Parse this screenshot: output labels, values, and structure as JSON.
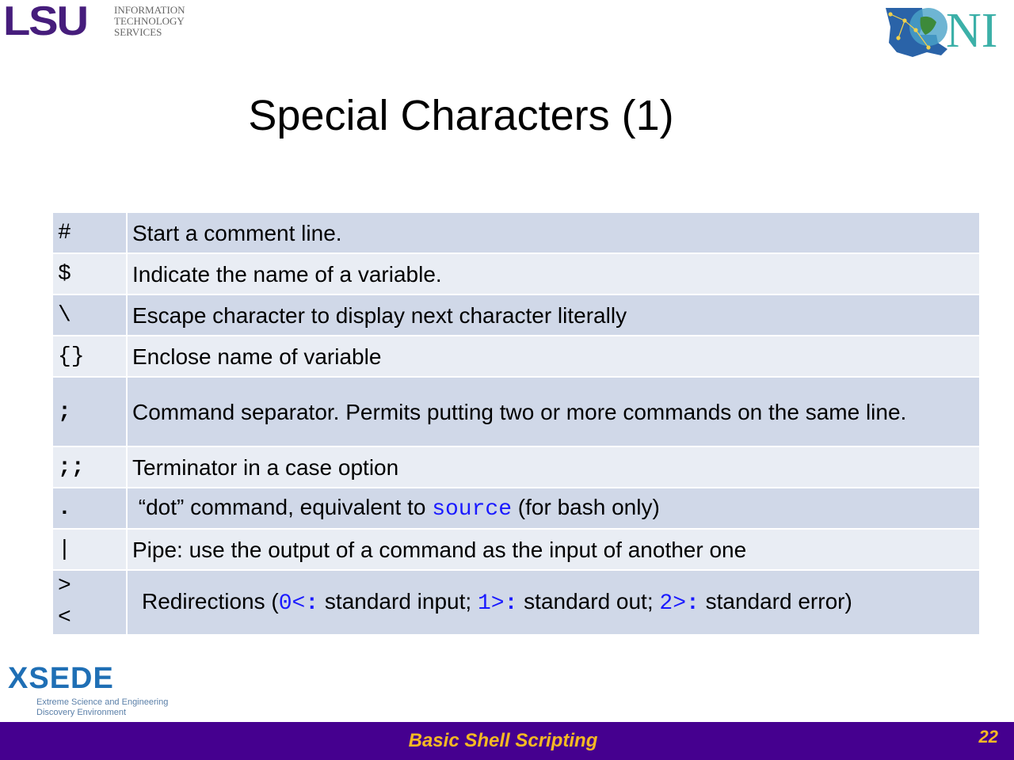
{
  "header": {
    "lsu": {
      "wordmark": "LSU",
      "subtitle": [
        "INFORMATION",
        "TECHNOLOGY",
        "SERVICES"
      ]
    },
    "loni": {
      "wordmark": "NI"
    }
  },
  "slide": {
    "title": "Special Characters (1)"
  },
  "table": {
    "rows": [
      {
        "symbol": "#",
        "description": "Start a comment line."
      },
      {
        "symbol": "$",
        "description": "Indicate the name of a variable."
      },
      {
        "symbol": "\\",
        "description": "Escape character to display next character literally"
      },
      {
        "symbol": "{}",
        "description": "Enclose name of variable"
      },
      {
        "symbol": ";",
        "description": "Command separator. Permits putting two or more commands on the same line."
      },
      {
        "symbol": ";;",
        "description": "Terminator in a case option"
      },
      {
        "symbol": ".",
        "desc_pre": "“dot” command, equivalent to ",
        "desc_code": "source",
        "desc_post": " (for bash only)"
      },
      {
        "symbol": "|",
        "description": "Pipe: use the output of a command as the input of another one"
      },
      {
        "symbol_lines": [
          ">",
          "<"
        ],
        "desc_parts": {
          "p1": "Redirections (",
          "c1a": "0<",
          "c1b": ":",
          "p2": " standard input; ",
          "c2a": "1>",
          "c2b": ":",
          "p3": " standard out; ",
          "c3a": "2>",
          "c3b": ":",
          "p4": " standard error)"
        }
      }
    ]
  },
  "xsede": {
    "wordmark": "XSEDE",
    "subtitle": [
      "Extreme Science and Engineering",
      "Discovery Environment"
    ]
  },
  "footer": {
    "title": "Basic Shell Scripting",
    "page_number": "22"
  },
  "colors": {
    "footer_bg": "#45008f",
    "footer_text": "#f6b923",
    "row_dark": "#d0d8e8",
    "row_light": "#e9edf4",
    "code_blue": "#1a1aff"
  }
}
